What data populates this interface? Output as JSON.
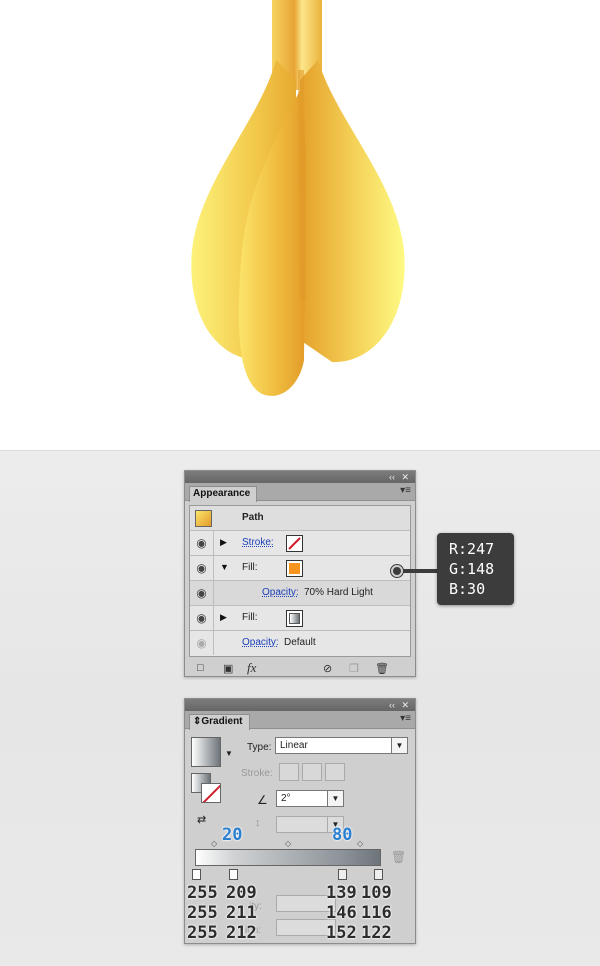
{
  "appearance": {
    "tab": "Appearance",
    "title": "Path",
    "rows": [
      {
        "label": "Stroke:",
        "swatch": "none"
      },
      {
        "label": "Fill:",
        "swatch": "#F7941E"
      },
      {
        "label": "Opacity:",
        "value": "70% Hard Light"
      },
      {
        "label": "Fill:",
        "swatch": "gradient"
      },
      {
        "label": "Opacity:",
        "value": "Default"
      }
    ],
    "bottom_icons": [
      "new-stroke-icon",
      "new-fill-icon",
      "fx-icon",
      "clear-icon",
      "duplicate-icon",
      "trash-icon"
    ]
  },
  "callout": {
    "r": "R:247",
    "g": "G:148",
    "b": "B:30"
  },
  "gradient": {
    "tab": "Gradient",
    "type_label": "Type:",
    "type_value": "Linear",
    "stroke_label": "Stroke:",
    "angle_value": "2°",
    "stop_locations": [
      "20",
      "80"
    ],
    "stops": [
      {
        "r": "255",
        "g": "255",
        "b": "255"
      },
      {
        "r": "209",
        "g": "211",
        "b": "212"
      },
      {
        "r": "139",
        "g": "146",
        "b": "152"
      },
      {
        "r": "109",
        "g": "116",
        "b": "122"
      }
    ]
  },
  "colors": {
    "fill_swatch": "#F7941E"
  }
}
